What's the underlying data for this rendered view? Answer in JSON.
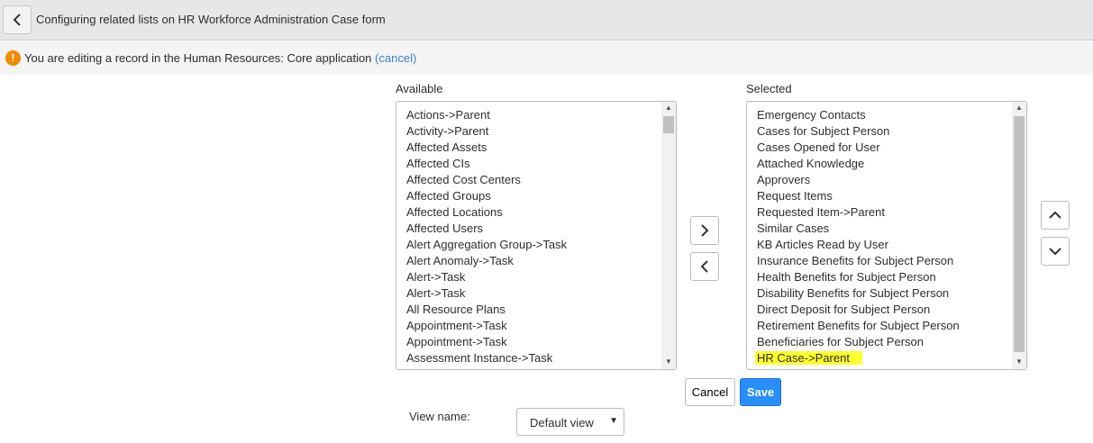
{
  "header": {
    "title": "Configuring related lists on HR Workforce Administration Case form"
  },
  "message": {
    "text": "You are editing a record in the Human Resources: Core application",
    "cancel_link": "(cancel)",
    "icon": "!"
  },
  "available": {
    "label": "Available",
    "items": [
      "Actions->Parent",
      "Activity->Parent",
      "Affected Assets",
      "Affected CIs",
      "Affected Cost Centers",
      "Affected Groups",
      "Affected Locations",
      "Affected Users",
      "Alert Aggregation Group->Task",
      "Alert Anomaly->Task",
      "Alert->Task",
      "Alert->Task",
      "All Resource Plans",
      "Appointment->Task",
      "Appointment->Task",
      "Assessment Instance->Task"
    ]
  },
  "selected": {
    "label": "Selected",
    "items": [
      "Emergency Contacts",
      "Cases for Subject Person",
      "Cases Opened for User",
      "Attached Knowledge",
      "Approvers",
      "Request Items",
      "Requested Item->Parent",
      "Similar Cases",
      "KB Articles Read by User",
      "Insurance Benefits for Subject Person",
      "Health Benefits for Subject Person",
      "Disability Benefits for Subject Person",
      "Direct Deposit for Subject Person",
      "Retirement Benefits for Subject Person",
      "Beneficiaries for Subject Person"
    ],
    "highlighted": "HR Case->Parent",
    "highlight_color": "#ffff30"
  },
  "buttons": {
    "cancel": "Cancel",
    "save": "Save"
  },
  "view": {
    "label": "View name:",
    "value": "Default view"
  }
}
